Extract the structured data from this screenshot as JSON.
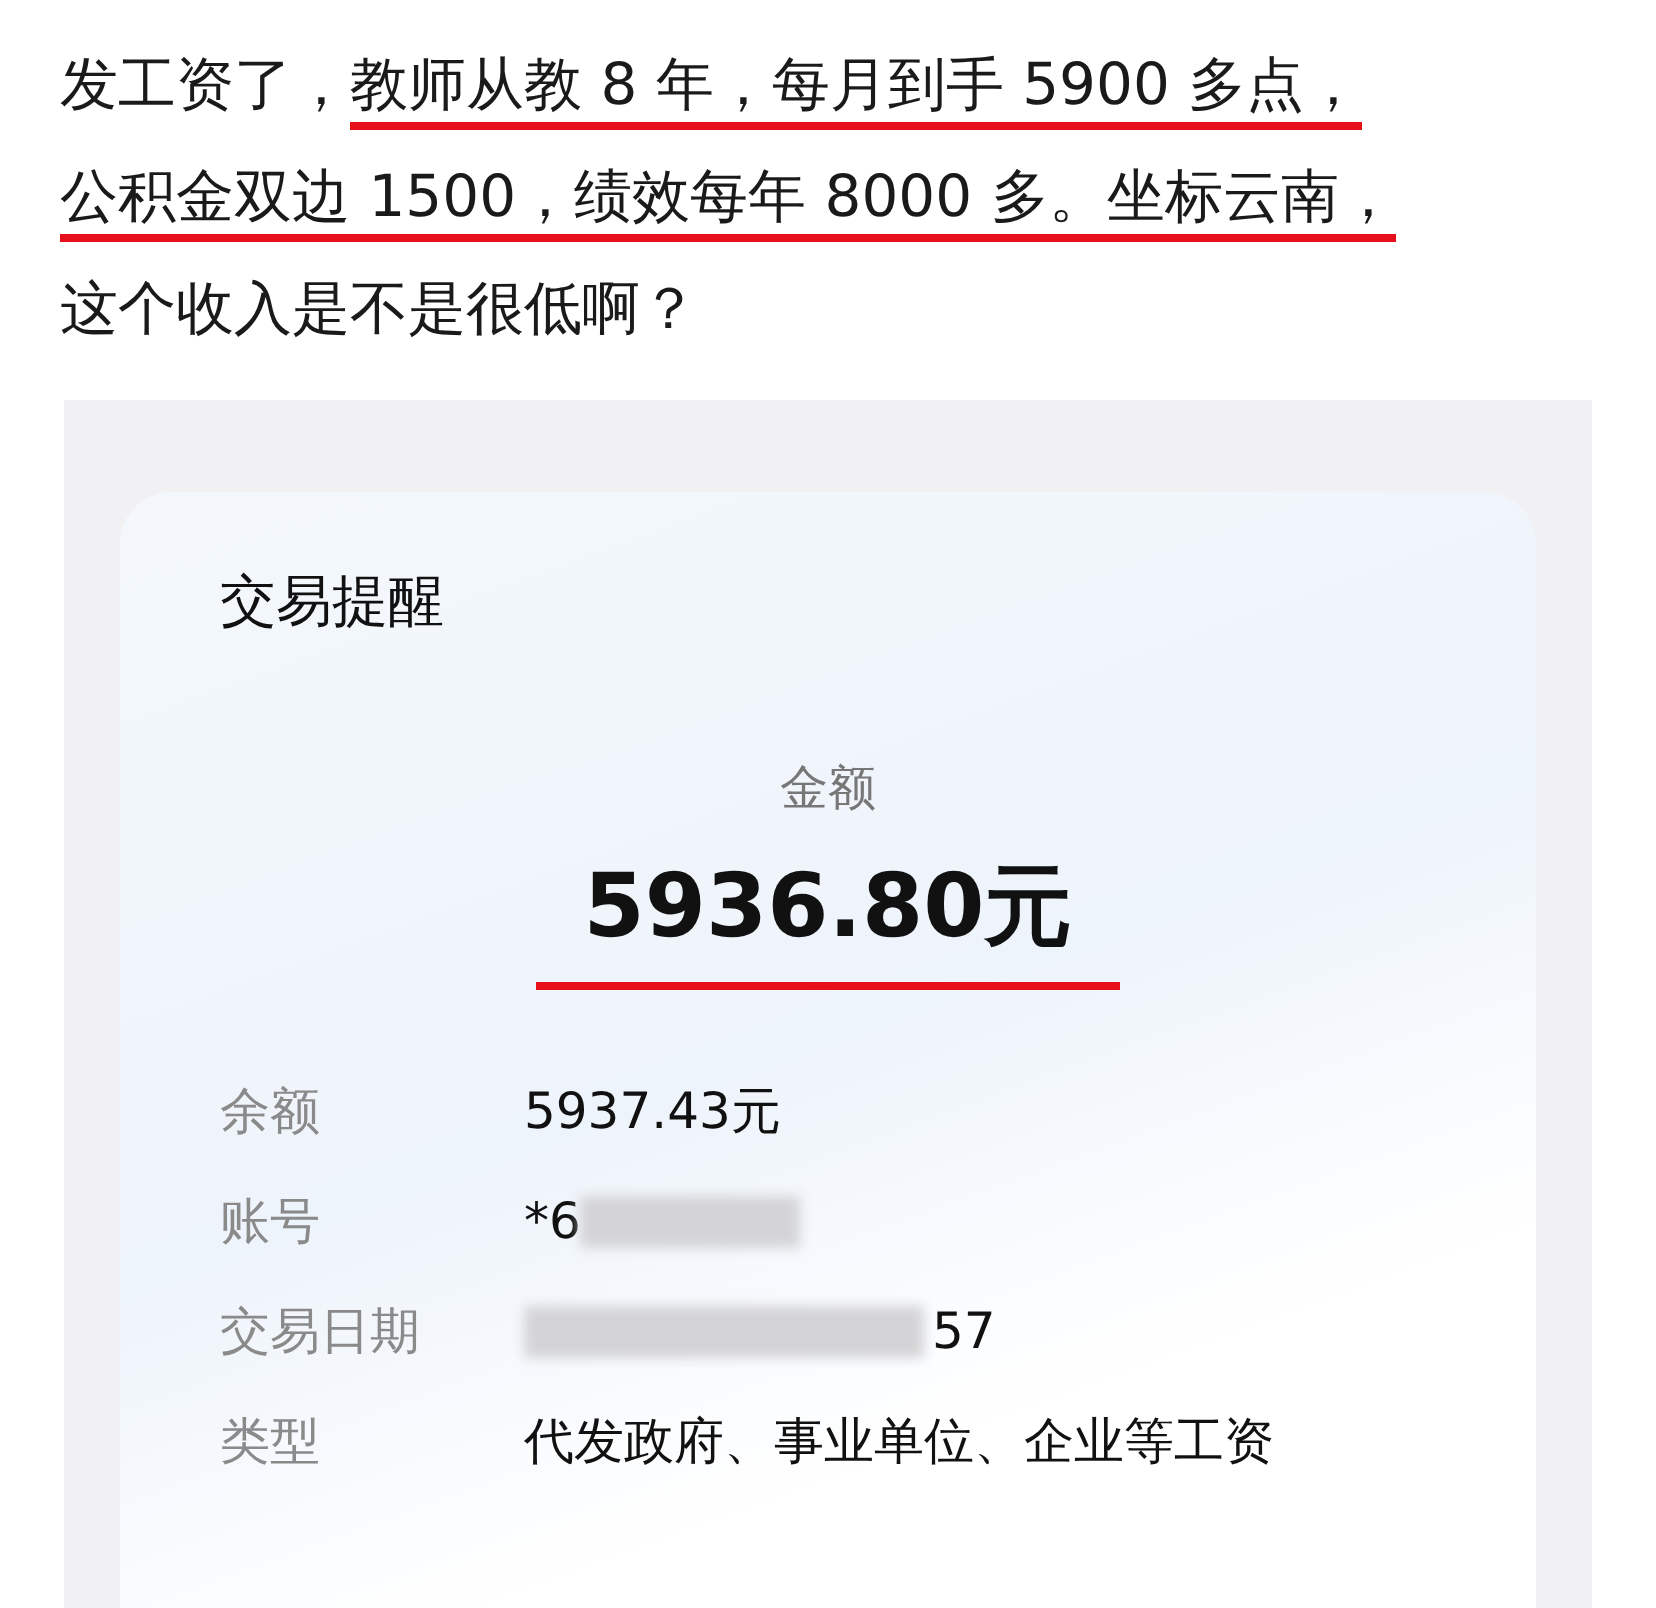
{
  "post": {
    "segments": [
      {
        "text": "发工资了，",
        "underlined": false
      },
      {
        "text": "教师从教 8 年，每月到手 5900 多点，",
        "underlined": true
      },
      {
        "text": "公积金双边 1500，绩效每年 8000 多。坐标云南，",
        "underlined": true
      },
      {
        "text": "这个收入是不是很低啊？",
        "underlined": false
      }
    ]
  },
  "card": {
    "title": "交易提醒",
    "amount_label": "金额",
    "amount": "5936.80元",
    "amount_underlined": true,
    "rows": [
      {
        "label": "余额",
        "value": "5937.43元",
        "redacted": false
      },
      {
        "label": "账号",
        "value": "*6",
        "redacted": true
      },
      {
        "label": "交易日期",
        "value": "57",
        "redacted": true
      },
      {
        "label": "类型",
        "value": "代发政府、事业单位、企业等工资",
        "redacted": false
      }
    ]
  }
}
